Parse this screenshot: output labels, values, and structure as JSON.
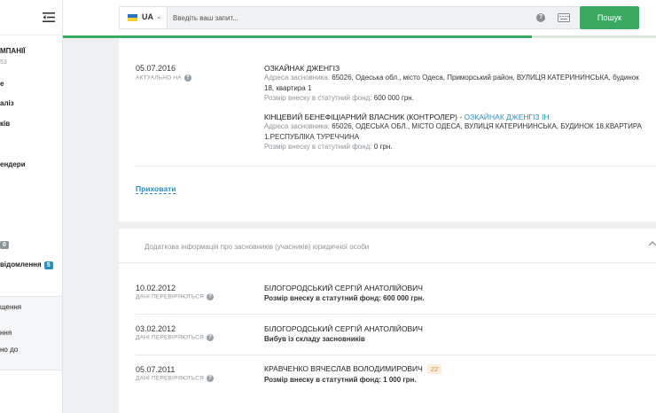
{
  "sidebar": {
    "company_title": "МПАНІЇ",
    "company_sub": "53",
    "items": [
      {
        "label": "е"
      },
      {
        "label": "аліз"
      },
      {
        "label": "ків"
      },
      {
        "label": "ендери"
      }
    ],
    "badge_item": {
      "badge": "0"
    },
    "notifications": {
      "label": "відомлення",
      "badge": "5"
    },
    "bottom_items": [
      {
        "label": "щення"
      },
      {
        "label": "ння"
      },
      {
        "label": "но до"
      }
    ]
  },
  "header": {
    "language": "UA",
    "search_placeholder": "Введіть ваш запит...",
    "search_button": "Пошук",
    "progress": 0.79
  },
  "founders_block": {
    "date": "05.07.2016",
    "status": "АКТУАЛЬНО НА",
    "founder": {
      "name": "ОЗКАЙНАК ДЖЕНГІЗ",
      "address_label": "Адреса засновника:",
      "address_value": "65026, Одеська обл., місто Одеса, Приморський район, ВУЛИЦЯ КАТЕРИНИНСЬКА, будинок 18, квартира 1",
      "contribution_label": "Розмір внеску в статутний фонд:",
      "contribution_value": "600 000 грн."
    },
    "beneficiary": {
      "label": "КІНЦЕВИЙ БЕНЕФІЦІАРНИЙ ВЛАСНИК (КОНТРОЛЕР) -",
      "name": "ОЗКАЙНАК ДЖЕНГІЗ ІН",
      "address_label": "Адреса засновника:",
      "address_value": "65026, ОДЕСЬКА ОБЛ., МІСТО ОДЕСА, ВУЛИЦЯ КАТЕРИНИНСЬКА, БУДИНОК 18,КВАРТИРА 1.РЕСПУБЛІКА ТУРЕЧЧИНА",
      "contribution_label": "Розмір внеску в статутний фонд:",
      "contribution_value": "0 грн."
    },
    "hide_link": "Приховати"
  },
  "additional_block": {
    "title": "Додаткова інформація про засновників (учасників) юридичної особи",
    "rows": [
      {
        "date": "10.02.2012",
        "status": "ДАНІ ПЕРЕВІРЯЮТЬСЯ",
        "name": "БІЛОГОРОДСЬКИЙ СЕРГІЙ АНАТОЛІЙОВИЧ",
        "detail": "Розмір внеску в статутний фонд: 600 000 грн."
      },
      {
        "date": "03.02.2012",
        "status": "ДАНІ ПЕРЕВІРЯЮТЬСЯ",
        "name": "БІЛОГОРОДСЬКИЙ СЕРГІЙ АНАТОЛІЙОВИЧ",
        "detail": "Вибув із складу засновників"
      },
      {
        "date": "05.07.2011",
        "status": "ДАНІ ПЕРЕВІРЯЮТЬСЯ",
        "name": "КРАВЧЕНКО ВЯЧЕСЛАВ ВОЛОДИМИРОВИЧ",
        "age_badge": "22",
        "detail": "Розмір внеску в статутний фонд: 1 000 грн."
      }
    ]
  },
  "colors": {
    "accent_green": "#3aaa63",
    "link_blue": "#2a8fbd",
    "badge_blue": "#2a8fbd"
  }
}
